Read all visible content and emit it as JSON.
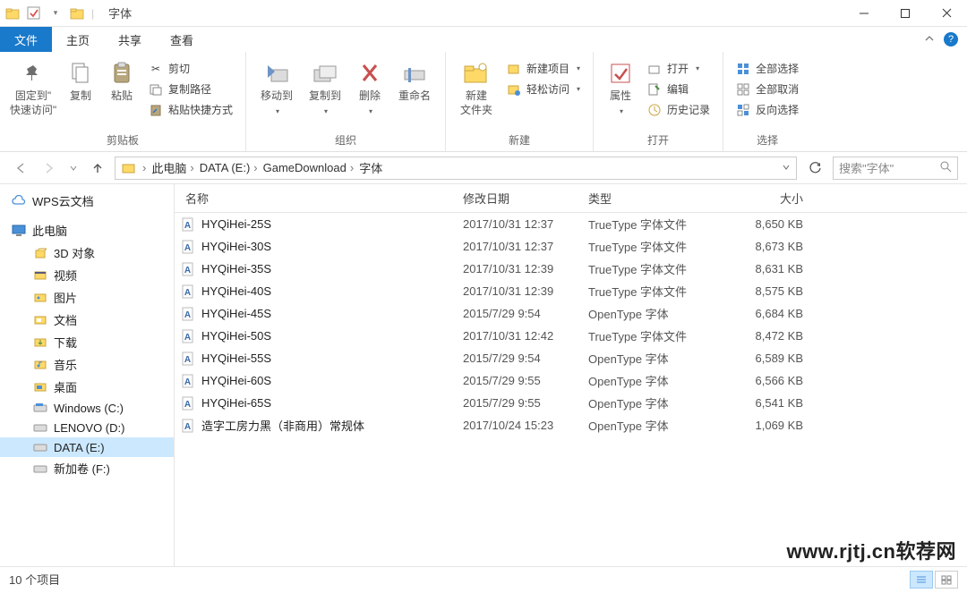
{
  "title": "字体",
  "tabs": {
    "file": "文件",
    "home": "主页",
    "share": "共享",
    "view": "查看"
  },
  "ribbon": {
    "clipboard": {
      "pin": "固定到\"\n快速访问\"",
      "copy": "复制",
      "paste": "粘贴",
      "cut": "剪切",
      "copypath": "复制路径",
      "pasteshortcut": "粘贴快捷方式",
      "group": "剪贴板"
    },
    "organize": {
      "moveto": "移动到",
      "copyto": "复制到",
      "delete": "删除",
      "rename": "重命名",
      "group": "组织"
    },
    "new": {
      "newfolder": "新建\n文件夹",
      "newitem": "新建项目",
      "easyaccess": "轻松访问",
      "group": "新建"
    },
    "open": {
      "properties": "属性",
      "open": "打开",
      "edit": "编辑",
      "history": "历史记录",
      "group": "打开"
    },
    "select": {
      "selectall": "全部选择",
      "selectnone": "全部取消",
      "invert": "反向选择",
      "group": "选择"
    }
  },
  "breadcrumbs": {
    "pc": "此电脑",
    "drive": "DATA (E:)",
    "folder1": "GameDownload",
    "folder2": "字体"
  },
  "search": {
    "placeholder": "搜索\"字体\""
  },
  "tree": {
    "wps": "WPS云文档",
    "pc": "此电脑",
    "objects3d": "3D 对象",
    "videos": "视频",
    "pictures": "图片",
    "documents": "文档",
    "downloads": "下载",
    "music": "音乐",
    "desktop": "桌面",
    "windowsc": "Windows (C:)",
    "lenovod": "LENOVO (D:)",
    "datae": "DATA (E:)",
    "newf": "新加卷 (F:)"
  },
  "columns": {
    "name": "名称",
    "date": "修改日期",
    "type": "类型",
    "size": "大小"
  },
  "files": [
    {
      "name": "HYQiHei-25S",
      "date": "2017/10/31 12:37",
      "type": "TrueType 字体文件",
      "size": "8,650 KB"
    },
    {
      "name": "HYQiHei-30S",
      "date": "2017/10/31 12:37",
      "type": "TrueType 字体文件",
      "size": "8,673 KB"
    },
    {
      "name": "HYQiHei-35S",
      "date": "2017/10/31 12:39",
      "type": "TrueType 字体文件",
      "size": "8,631 KB"
    },
    {
      "name": "HYQiHei-40S",
      "date": "2017/10/31 12:39",
      "type": "TrueType 字体文件",
      "size": "8,575 KB"
    },
    {
      "name": "HYQiHei-45S",
      "date": "2015/7/29 9:54",
      "type": "OpenType 字体",
      "size": "6,684 KB"
    },
    {
      "name": "HYQiHei-50S",
      "date": "2017/10/31 12:42",
      "type": "TrueType 字体文件",
      "size": "8,472 KB"
    },
    {
      "name": "HYQiHei-55S",
      "date": "2015/7/29 9:54",
      "type": "OpenType 字体",
      "size": "6,589 KB"
    },
    {
      "name": "HYQiHei-60S",
      "date": "2015/7/29 9:55",
      "type": "OpenType 字体",
      "size": "6,566 KB"
    },
    {
      "name": "HYQiHei-65S",
      "date": "2015/7/29 9:55",
      "type": "OpenType 字体",
      "size": "6,541 KB"
    },
    {
      "name": "造字工房力黑（非商用）常规体",
      "date": "2017/10/24 15:23",
      "type": "OpenType 字体",
      "size": "1,069 KB"
    }
  ],
  "status": {
    "count": "10 个项目"
  },
  "watermark": "www.rjtj.cn软荐网"
}
